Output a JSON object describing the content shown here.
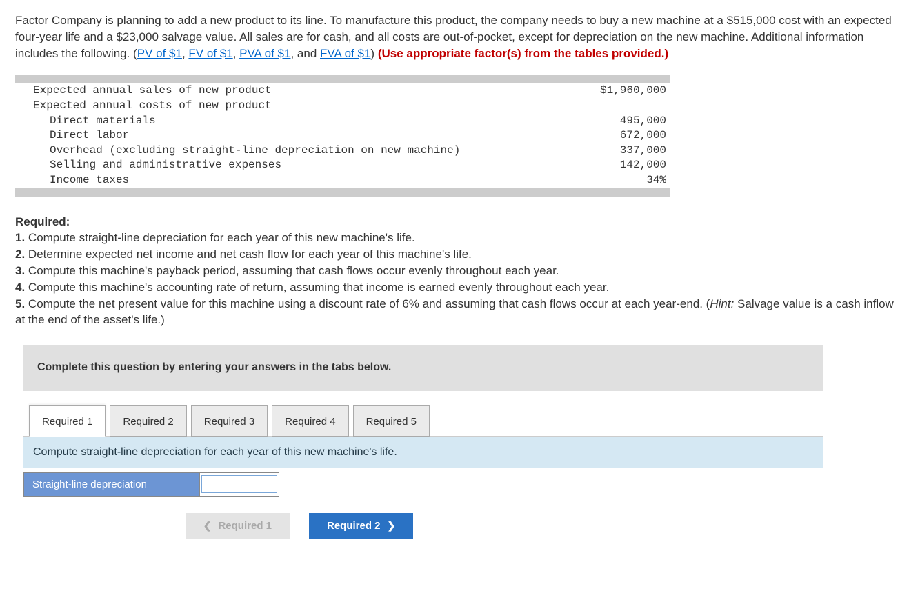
{
  "problem": {
    "intro_a": "Factor Company is planning to add a new product to its line. To manufacture this product, the company needs to buy a new machine at a $515,000 cost with an expected four-year life and a $23,000 salvage value. All sales are for cash, and all costs are out-of-pocket, except for depreciation on the new machine. Additional information includes the following. (",
    "link1": "PV of $1",
    "sep": ", ",
    "link2": "FV of $1",
    "link3": "PVA of $1",
    "and": ", and ",
    "link4": "FVA of $1",
    "close_paren": ") ",
    "red_note": "(Use appropriate factor(s) from the tables provided.)"
  },
  "data_rows": {
    "r1_label": "Expected annual sales of new product",
    "r1_val": "$1,960,000",
    "r2_label": "Expected annual costs of new product",
    "r3_label": "Direct materials",
    "r3_val": "495,000",
    "r4_label": "Direct labor",
    "r4_val": "672,000",
    "r5_label": "Overhead (excluding straight-line depreciation on new machine)",
    "r5_val": "337,000",
    "r6_label": "Selling and administrative expenses",
    "r6_val": "142,000",
    "r7_label": "Income taxes",
    "r7_val": "34%"
  },
  "required": {
    "heading": "Required:",
    "item1_num": "1.",
    "item1": " Compute straight-line depreciation for each year of this new machine's life.",
    "item2_num": "2.",
    "item2": " Determine expected net income and net cash flow for each year of this machine's life.",
    "item3_num": "3.",
    "item3": " Compute this machine's payback period, assuming that cash flows occur evenly throughout each year.",
    "item4_num": "4.",
    "item4": " Compute this machine's accounting rate of return, assuming that income is earned evenly throughout each year.",
    "item5_num": "5.",
    "item5": " Compute the net present value for this machine using a discount rate of 6% and assuming that cash flows occur at each year-end. (",
    "hint_label": "Hint:",
    "hint_text": " Salvage value is a cash inflow at the end of the asset's life.)"
  },
  "answer": {
    "instruction": "Complete this question by entering your answers in the tabs below.",
    "tabs": [
      "Required 1",
      "Required 2",
      "Required 3",
      "Required 4",
      "Required 5"
    ],
    "sub_instruction": "Compute straight-line depreciation for each year of this new machine's life.",
    "row_label": "Straight-line depreciation",
    "input_value": ""
  },
  "nav": {
    "prev_label": "Required 1",
    "next_label": "Required 2"
  }
}
